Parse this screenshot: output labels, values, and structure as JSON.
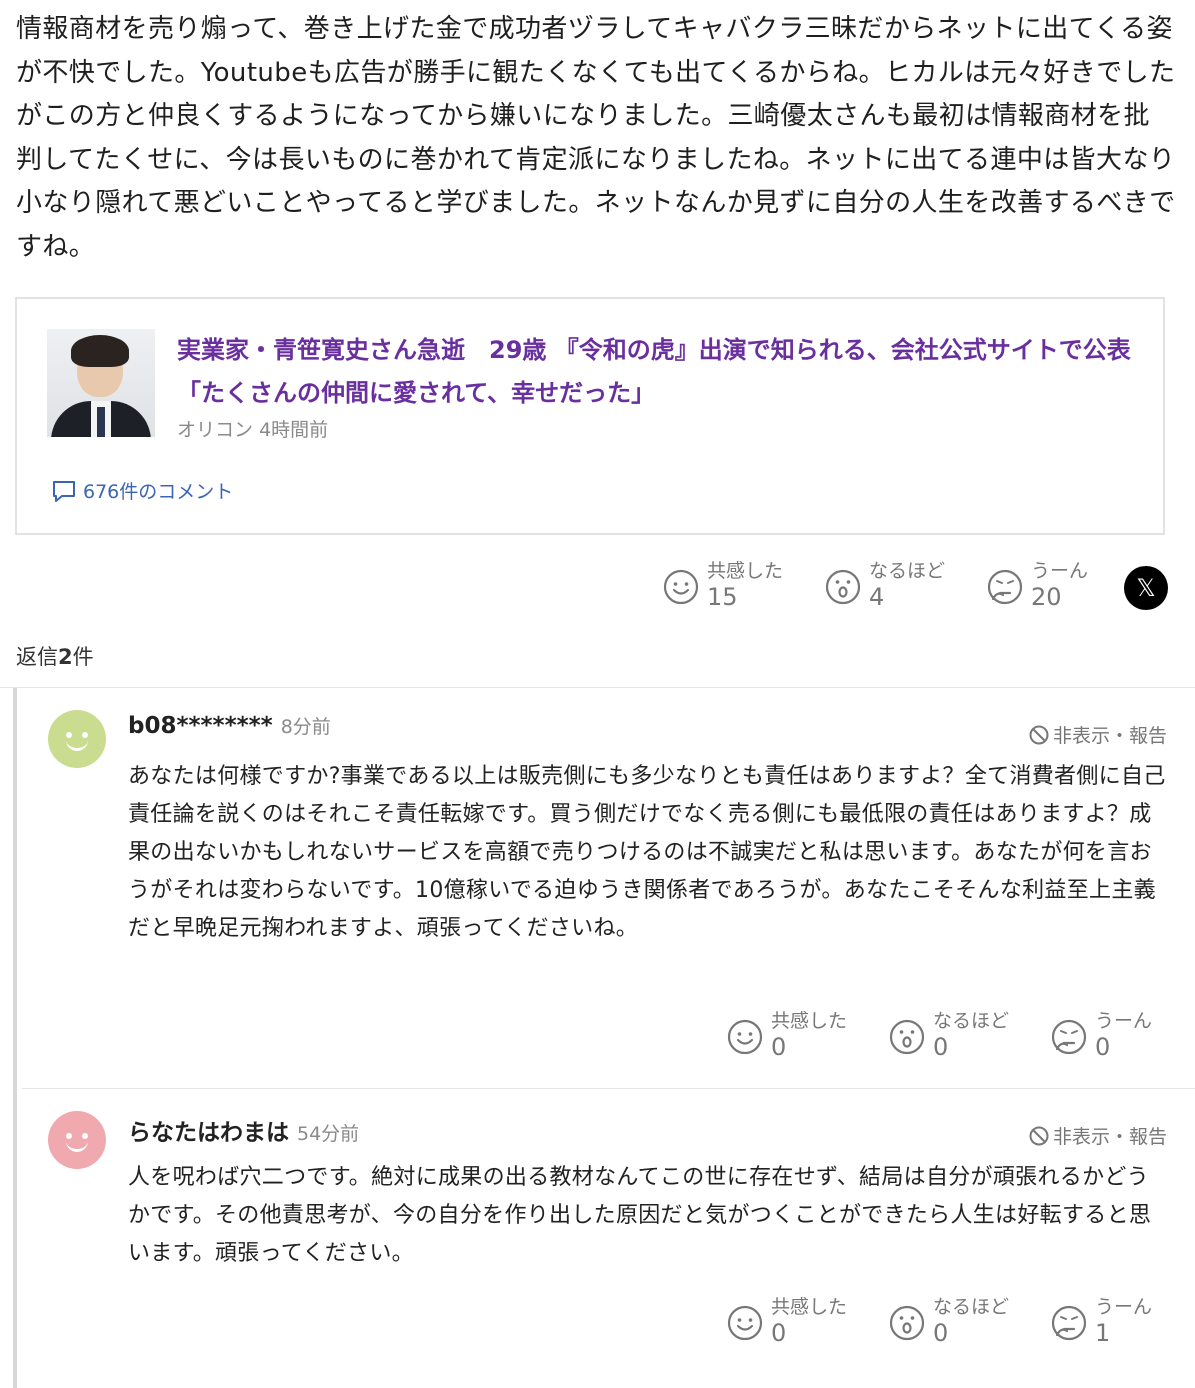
{
  "comment": {
    "text": "情報商材を売り煽って、巻き上げた金で成功者ヅラしてキャバクラ三昧だからネットに出てくる姿が不快でした。Youtubeも広告が勝手に観たくなくても出てくるからね。ヒカルは元々好きでしたがこの方と仲良くするようになってから嫌いになりました。三崎優太さんも最初は情報商材を批判してたくせに、今は長いものに巻かれて肯定派になりましたね。ネットに出てる連中は皆大なり小なり隠れて悪どいことやってると学びました。ネットなんか見ずに自分の人生を改善するべきですね。"
  },
  "article": {
    "title": "実業家・青笹寛史さん急逝　29歳 『令和の虎』出演で知られる、会社公式サイトで公表「たくさんの仲間に愛されて、幸せだった」",
    "source": "オリコン",
    "time": "4時間前",
    "comments_link": "676件のコメント"
  },
  "reactions": {
    "empathy_label": "共感した",
    "empathy_count": "15",
    "naruhodo_label": "なるほど",
    "naruhodo_count": "4",
    "uun_label": "うーん",
    "uun_count": "20",
    "share_icon": "x-logo-icon",
    "share_glyph": "𝕏"
  },
  "replies_header": {
    "prefix": "返信",
    "count": "2",
    "suffix": "件"
  },
  "replies": [
    {
      "user": "b08********",
      "time": "8分前",
      "hide_label": "非表示・報告",
      "avatar_color": "#c9dc8f",
      "text": "あなたは何様ですか?事業である以上は販売側にも多少なりとも責任はありますよ？全て消費者側に自己責任論を説くのはそれこそ責任転嫁です。買う側だけでなく売る側にも最低限の責任はありますよ？成果の出ないかもしれないサービスを高額で売りつけるのは不誠実だと私は思います。あなたが何を言おうがそれは変わらないです。10億稼いでる迫ゆうき関係者であろうが。あなたこそそんな利益至上主義だと早晩足元掬われますよ、頑張ってくださいね。",
      "empathy_label": "共感した",
      "empathy_count": "0",
      "naruhodo_label": "なるほど",
      "naruhodo_count": "0",
      "uun_label": "うーん",
      "uun_count": "0"
    },
    {
      "user": "らなたはわまは",
      "time": "54分前",
      "hide_label": "非表示・報告",
      "avatar_color": "#f0a9ae",
      "text": "人を呪わば穴二つです。絶対に成果の出る教材なんてこの世に存在せず、結局は自分が頑張れるかどうかです。その他責思考が、今の自分を作り出した原因だと気がつくことができたら人生は好転すると思います。頑張ってください。",
      "empathy_label": "共感した",
      "empathy_count": "0",
      "naruhodo_label": "なるほど",
      "naruhodo_count": "0",
      "uun_label": "うーん",
      "uun_count": "1"
    }
  ]
}
